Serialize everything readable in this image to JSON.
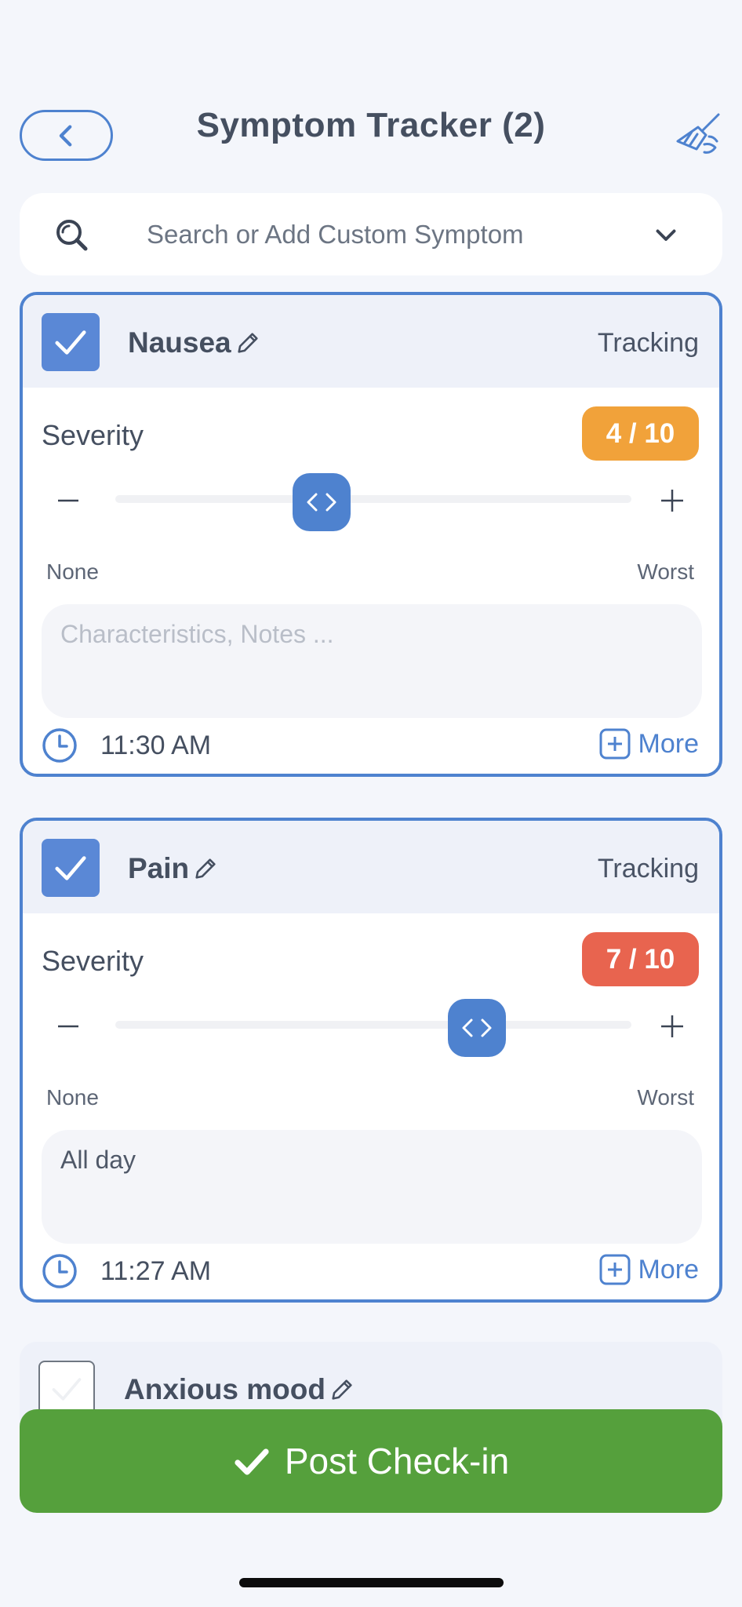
{
  "header": {
    "title": "Symptom Tracker (2)"
  },
  "search": {
    "placeholder": "Search or Add Custom Symptom"
  },
  "symptoms": [
    {
      "name": "Nausea",
      "status": "Tracking",
      "checked": true,
      "severity_label": "Severity",
      "severity_value": 4,
      "severity_text": "4 / 10",
      "badge_color": "#f1a23a",
      "scale_min": "None",
      "scale_max": "Worst",
      "notes_placeholder": "Characteristics, Notes ...",
      "notes": "",
      "time": "11:30 AM",
      "more_label": "More"
    },
    {
      "name": "Pain",
      "status": "Tracking",
      "checked": true,
      "severity_label": "Severity",
      "severity_value": 7,
      "severity_text": "7 / 10",
      "badge_color": "#e8644f",
      "scale_min": "None",
      "scale_max": "Worst",
      "notes_placeholder": "",
      "notes": "All day",
      "time": "11:27 AM",
      "more_label": "More"
    },
    {
      "name": "Anxious mood",
      "checked": false
    }
  ],
  "post_button": {
    "label": "Post Check-in"
  },
  "colors": {
    "accent": "#4e82cf",
    "post": "#55a03c"
  }
}
